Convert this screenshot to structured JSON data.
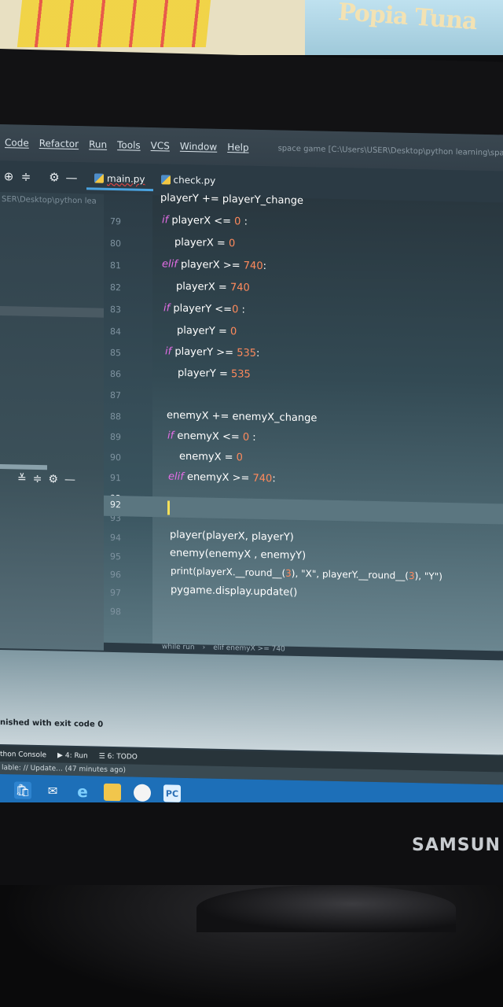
{
  "poster": {
    "title": "Popia Tuna"
  },
  "menu": {
    "items": [
      "Code",
      "Refactor",
      "Run",
      "Tools",
      "VCS",
      "Window",
      "Help"
    ],
    "window_title": "space game [C:\\Users\\USER\\Desktop\\python learning\\space g"
  },
  "toolbar": {
    "icons": [
      "globe-icon",
      "collapse-icon",
      "gear-icon",
      "minimize-icon"
    ],
    "tabs": [
      {
        "label": "main.py",
        "active": true
      },
      {
        "label": "check.py",
        "active": false
      }
    ]
  },
  "project": {
    "path": "SER\\Desktop\\python lea"
  },
  "editor": {
    "lines": [
      {
        "no": "",
        "text": "playerY += playerY_change"
      },
      {
        "no": "79",
        "text": "if playerX <= 0 :"
      },
      {
        "no": "80",
        "text": "playerX = 0"
      },
      {
        "no": "81",
        "text": "elif playerX >= 740:"
      },
      {
        "no": "82",
        "text": "playerX = 740"
      },
      {
        "no": "83",
        "text": "if playerY <=0 :"
      },
      {
        "no": "84",
        "text": "playerY = 0"
      },
      {
        "no": "85",
        "text": "if playerY >= 535:"
      },
      {
        "no": "86",
        "text": "playerY = 535"
      },
      {
        "no": "87",
        "text": ""
      },
      {
        "no": "88",
        "text": "enemyX += enemyX_change"
      },
      {
        "no": "89",
        "text": "if enemyX <= 0 :"
      },
      {
        "no": "90",
        "text": "enemyX = 0"
      },
      {
        "no": "91",
        "text": "elif enemyX >= 740:"
      },
      {
        "no": "92",
        "text": ""
      },
      {
        "no": "93",
        "text": ""
      },
      {
        "no": "94",
        "text": "player(playerX, playerY)"
      },
      {
        "no": "95",
        "text": "enemy(enemyX , enemyY)"
      },
      {
        "no": "96",
        "text": "print(playerX.__round__(3), \"X\", playerY.__round__(3), \"Y\")"
      },
      {
        "no": "97",
        "text": "pygame.display.update()"
      },
      {
        "no": "98",
        "text": ""
      }
    ],
    "current_line": "92",
    "breadcrumb": [
      "while run",
      "elif enemyX >= 740"
    ]
  },
  "run": {
    "output": "nished with exit code 0"
  },
  "tool_tabs": [
    "thon Console",
    "4: Run",
    "6: TODO"
  ],
  "statusbar": {
    "text": "lable: // Update... (47 minutes ago)"
  },
  "taskbar": {
    "icons": [
      "store-icon",
      "mail-icon",
      "edge-icon",
      "folder-icon",
      "chrome-icon",
      "pycharm-icon"
    ]
  },
  "monitor": {
    "brand": "SAMSUN"
  }
}
